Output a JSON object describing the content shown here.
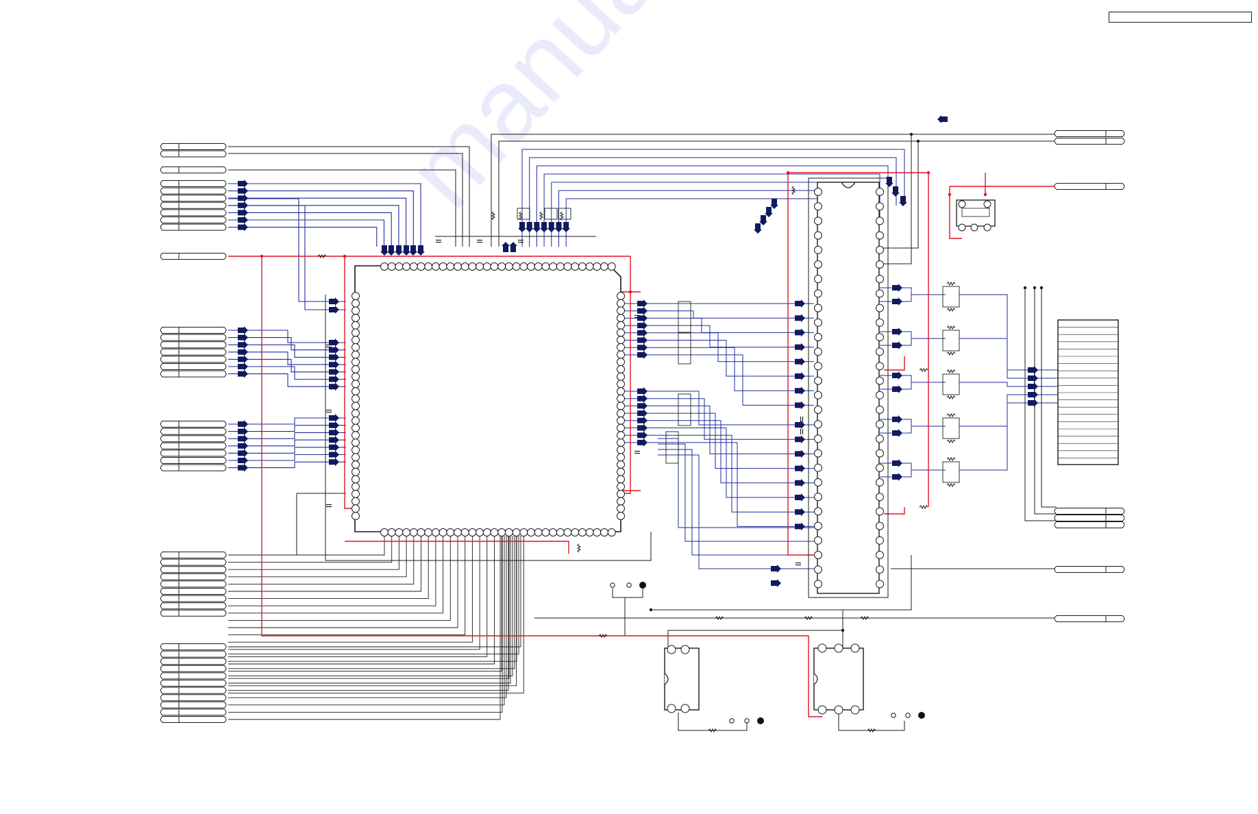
{
  "diagram": {
    "kind": "circuit-schematic",
    "watermark_text": "manualmachine.com",
    "colors": {
      "power_net": "#e0141e",
      "signal_bus": "#1f2a9c",
      "wire": "#1a1a1a",
      "arrow": "#0f1a5e"
    },
    "components": [
      {
        "id": "main-ic",
        "type": "qfp-ic",
        "pins_per_side": [
          32,
          28,
          32,
          28
        ]
      },
      {
        "id": "dip-ic",
        "type": "dip-ic",
        "pins_per_side": 28
      },
      {
        "id": "connector-right",
        "type": "header-connector"
      },
      {
        "id": "small-ic-a",
        "type": "8-pin-ic"
      },
      {
        "id": "small-ic-b",
        "type": "8-pin-ic"
      },
      {
        "id": "regulator",
        "type": "4-pin-regulator"
      }
    ]
  }
}
